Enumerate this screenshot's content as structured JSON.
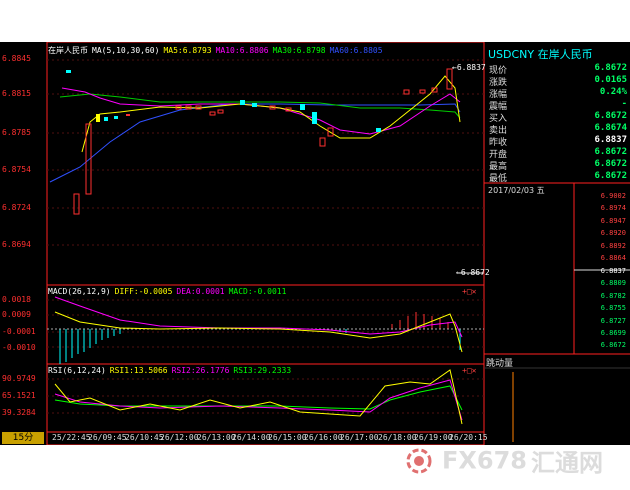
{
  "main_panel": {
    "title": "在岸人民币",
    "ma_params": "MA(5,10,30,60)",
    "ma5": "MA5:6.8793",
    "ma10": "MA10:6.8806",
    "ma30": "MA30:6.8798",
    "ma60": "MA60:6.8805",
    "y_labels": [
      "6.8845",
      "6.8815",
      "6.8785",
      "6.8754",
      "6.8724",
      "6.8694"
    ],
    "high_marker": "←6.8837",
    "low_marker": "←6.8672"
  },
  "macd_panel": {
    "title": "MACD(26,12,9)",
    "diff": "DIFF:-0.0005",
    "dea": "DEA:0.0001",
    "macd": "MACD:-0.0011",
    "y_labels": [
      "0.0018",
      "0.0009",
      "-0.0001",
      "-0.0010"
    ]
  },
  "rsi_panel": {
    "title": "RSI(6,12,24)",
    "rsi1": "RSI1:13.5066",
    "rsi2": "RSI2:26.1776",
    "rsi3": "RSI3:29.2333",
    "y_labels": [
      "90.9749",
      "65.1521",
      "39.3284"
    ]
  },
  "period_button": "15分",
  "time_labels": [
    "25/22:45",
    "26/09:45",
    "26/10:45",
    "26/12:00",
    "26/13:00",
    "26/14:00",
    "26/15:00",
    "26/16:00",
    "26/17:00",
    "26/18:00",
    "26/19:00",
    "26/20:15"
  ],
  "quote": {
    "symbol": "USDCNY 在岸人民币",
    "rows": [
      {
        "label": "现价",
        "value": "6.8672"
      },
      {
        "label": "涨跌",
        "value": "0.0165"
      },
      {
        "label": "涨幅",
        "value": "0.24%"
      },
      {
        "label": "震幅",
        "value": "-"
      },
      {
        "label": "买入",
        "value": "6.8672"
      },
      {
        "label": "卖出",
        "value": "6.8674"
      },
      {
        "label": "昨收",
        "value": "6.8837"
      },
      {
        "label": "开盘",
        "value": "6.8672"
      },
      {
        "label": "最高",
        "value": "6.8672"
      },
      {
        "label": "最低",
        "value": "6.8672"
      }
    ]
  },
  "tick_date": "2017/02/03 五",
  "tick_scale": [
    "6.9002",
    "6.8974",
    "6.8947",
    "6.8920",
    "6.8892",
    "6.8864",
    "6.8837",
    "6.8809",
    "6.8782",
    "6.8755",
    "6.8727",
    "6.8699",
    "6.8672"
  ],
  "volume_label": "跳动量",
  "watermark": {
    "brand": "FX678",
    "cn": "汇通网"
  },
  "colors": {
    "up": "#ff3030",
    "down": "#00ffff",
    "ma5": "#ffff00",
    "ma10": "#ff00ff",
    "ma30": "#00ff00",
    "ma60": "#3050ff"
  }
}
